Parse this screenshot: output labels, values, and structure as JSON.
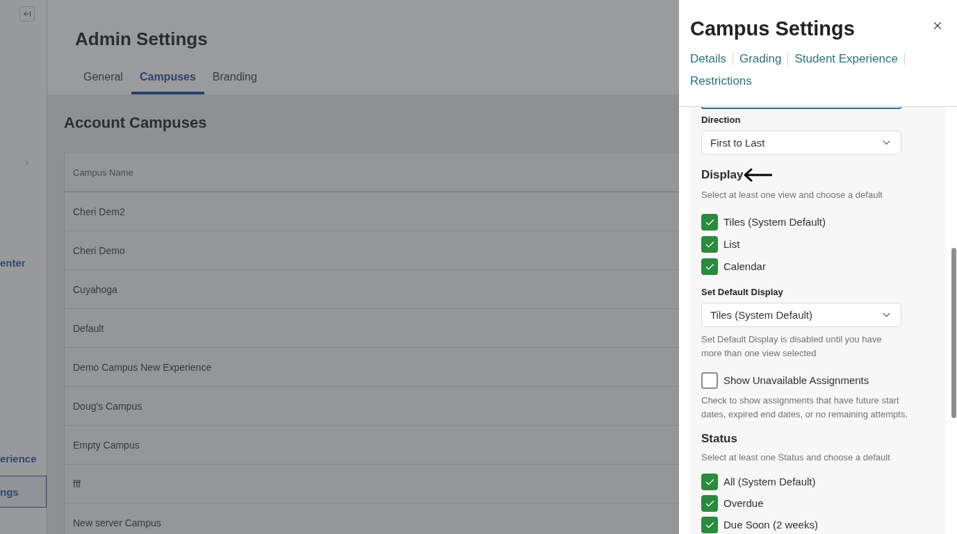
{
  "sidebar": {
    "items": [
      {
        "label": "enter",
        "selected": false
      },
      {
        "label": "erience",
        "selected": false
      },
      {
        "label": "ngs",
        "selected": true
      }
    ]
  },
  "page": {
    "title": "Admin Settings",
    "tabs": [
      {
        "label": "General",
        "selected": false
      },
      {
        "label": "Campuses",
        "selected": true
      },
      {
        "label": "Branding",
        "selected": false
      }
    ]
  },
  "campuses": {
    "title": "Account Campuses",
    "columns": [
      "Campus Name"
    ],
    "rows": [
      "Cheri Dem2",
      "Cheri Demo",
      "Cuyahoga",
      "Default",
      "Demo Campus New Experience",
      "Doug's Campus",
      "Empty Campus",
      "fff",
      "New server Campus"
    ]
  },
  "panel": {
    "title": "Campus Settings",
    "sections": [
      "Details",
      "Grading",
      "Student Experience",
      "Restrictions"
    ],
    "direction": {
      "label": "Direction",
      "value": "First to Last"
    },
    "display": {
      "heading": "Display",
      "hint": "Select at least one view and choose a default",
      "options": [
        {
          "label": "Tiles (System Default)",
          "checked": true
        },
        {
          "label": "List",
          "checked": true
        },
        {
          "label": "Calendar",
          "checked": true
        }
      ],
      "default_label": "Set Default Display",
      "default_value": "Tiles (System Default)",
      "default_note": "Set Default Display is disabled until you have more than one view selected"
    },
    "unavailable": {
      "label": "Show Unavailable Assignments",
      "checked": false,
      "note": "Check to show assignments that have future start dates, expired end dates, or no remaining attempts."
    },
    "status": {
      "heading": "Status",
      "hint": "Select at least one Status and choose a default",
      "options": [
        {
          "label": "All (System Default)",
          "checked": true
        },
        {
          "label": "Overdue",
          "checked": true
        },
        {
          "label": "Due Soon (2 weeks)",
          "checked": true
        }
      ]
    }
  }
}
